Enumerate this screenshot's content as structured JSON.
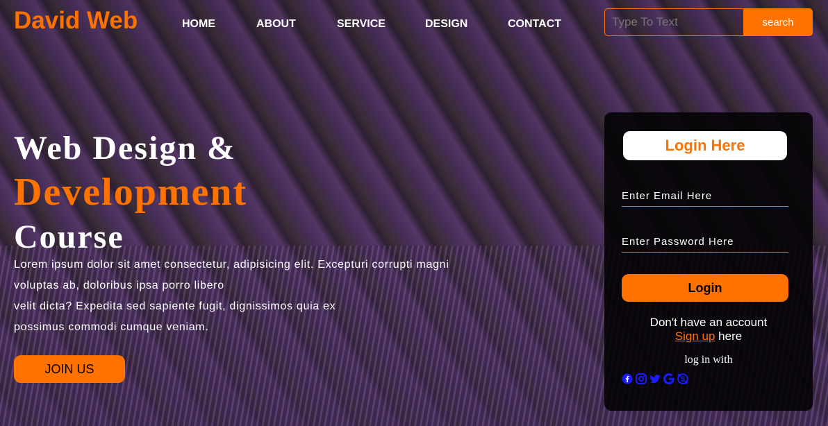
{
  "header": {
    "logo": "David Web",
    "nav": [
      "HOME",
      "ABOUT",
      "SERVICE",
      "DESIGN",
      "CONTACT"
    ],
    "search_placeholder": "Type To Text",
    "search_button": "search"
  },
  "hero": {
    "line1": "Web Design &",
    "line2": "Development",
    "line3": "Course",
    "paragraph": [
      "Lorem ipsum dolor sit amet consectetur, adipisicing elit. Excepturi corrupti magni",
      "voluptas ab, doloribus ipsa porro libero",
      "velit dicta? Expedita sed sapiente fugit, dignissimos quia ex",
      "possimus commodi cumque veniam."
    ],
    "join_button": "JOIN US"
  },
  "login": {
    "title": "Login Here",
    "email_placeholder": "Enter Email Here",
    "password_placeholder": "Enter Password Here",
    "button": "Login",
    "account_text": "Don't have an account",
    "signup_link": "Sign up",
    "signup_suffix": " here",
    "login_with": "log in with",
    "social_icons": [
      "facebook-icon",
      "instagram-icon",
      "twitter-icon",
      "google-icon",
      "skype-icon"
    ]
  },
  "colors": {
    "accent": "#ff7200",
    "social_icon": "#1a1aff"
  }
}
